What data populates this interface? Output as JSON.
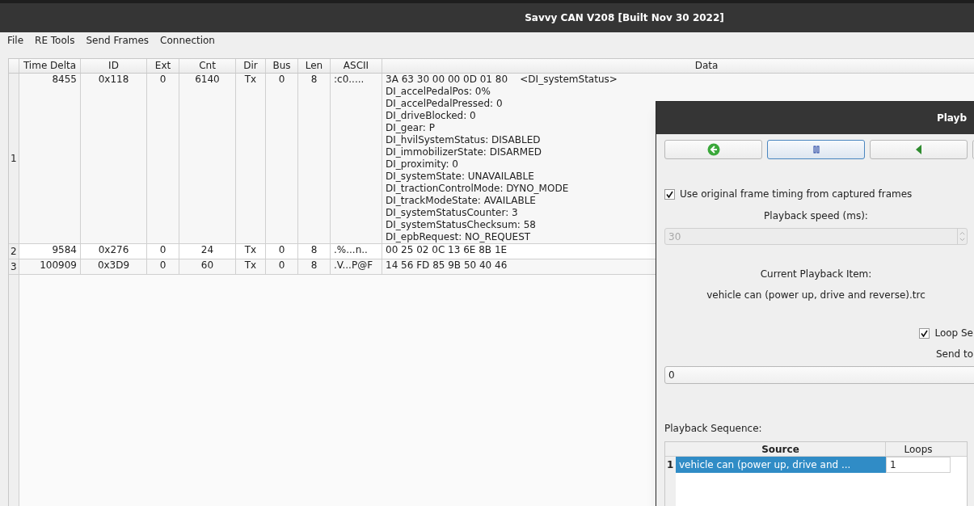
{
  "window": {
    "title": "Savvy CAN V208 [Built Nov 30 2022]"
  },
  "menu": [
    "File",
    "RE Tools",
    "Send Frames",
    "Connection"
  ],
  "table": {
    "columns": [
      "Time Delta",
      "ID",
      "Ext",
      "Cnt",
      "Dir",
      "Bus",
      "Len",
      "ASCII",
      "Data"
    ],
    "rows": [
      {
        "number": "1",
        "cells": [
          "8455",
          "0x118",
          "0",
          "6140",
          "Tx",
          "0",
          "8",
          ":c0.....",
          "3A 63 30 00 00 0D 01 80    <DI_systemStatus>\nDI_accelPedalPos: 0%\nDI_accelPedalPressed: 0\nDI_driveBlocked: 0\nDI_gear: P\nDI_hvilSystemStatus: DISABLED\nDI_immobilizerState: DISARMED\nDI_proximity: 0\nDI_systemState: UNAVAILABLE\nDI_tractionControlMode: DYNO_MODE\nDI_trackModeState: AVAILABLE\nDI_systemStatusCounter: 3\nDI_systemStatusChecksum: 58\nDI_epbRequest: NO_REQUEST"
        ]
      },
      {
        "number": "2",
        "cells": [
          "9584",
          "0x276",
          "0",
          "24",
          "Tx",
          "0",
          "8",
          ".%...n..",
          "00 25 02 0C 13 6E 8B 1E"
        ]
      },
      {
        "number": "3",
        "cells": [
          "100909",
          "0x3D9",
          "0",
          "60",
          "Tx",
          "0",
          "8",
          ".V...P@F",
          "14 56 FD 85 9B 50 40 46"
        ]
      }
    ]
  },
  "dialog": {
    "title": "Playb",
    "buttons": [
      {
        "kind": "back",
        "selected": false
      },
      {
        "kind": "pause",
        "selected": true
      },
      {
        "kind": "step-back",
        "selected": false
      }
    ],
    "use_original_timing": {
      "label": "Use original frame timing from captured frames",
      "checked": true
    },
    "speed_label": "Playback speed (ms):",
    "speed": {
      "value": "30",
      "disabled": true
    },
    "current_item_label": "Current Playback Item:",
    "current_item": "vehicle can (power up, drive and reverse).trc",
    "loop": {
      "label": "Loop Se",
      "checked": true
    },
    "send_to_label": "Send to",
    "send_to": {
      "value": "0"
    },
    "sequence_label": "Playback Sequence:",
    "sequence": {
      "columns": [
        "Source",
        "Loops"
      ],
      "rows": [
        {
          "number": "1",
          "source": "vehicle can (power up, drive and ...",
          "loops": "1",
          "selected": true
        }
      ]
    }
  }
}
